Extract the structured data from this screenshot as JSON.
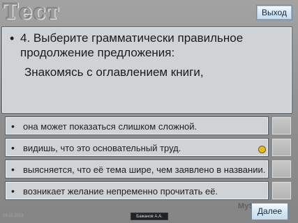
{
  "slide": {
    "title": "Тест",
    "exit_label": "Выход",
    "next_label": "Далее",
    "watermark": "MyShared",
    "date": "18.11.2013",
    "author": "Бажанов А.А."
  },
  "question": {
    "line1": "4.  Выберите грамматически правильное продолжение предложения:",
    "line2": "Знакомясь с оглавлением книги,"
  },
  "answers": [
    "она может показаться слишком сложной.",
    "видишь, что это основательный труд.",
    "выясняется, что её тема шире, чем заявлено в  названии.",
    "возникает желание непременно прочитать её."
  ],
  "colors": {
    "selected_marker": "#e0bc27"
  }
}
